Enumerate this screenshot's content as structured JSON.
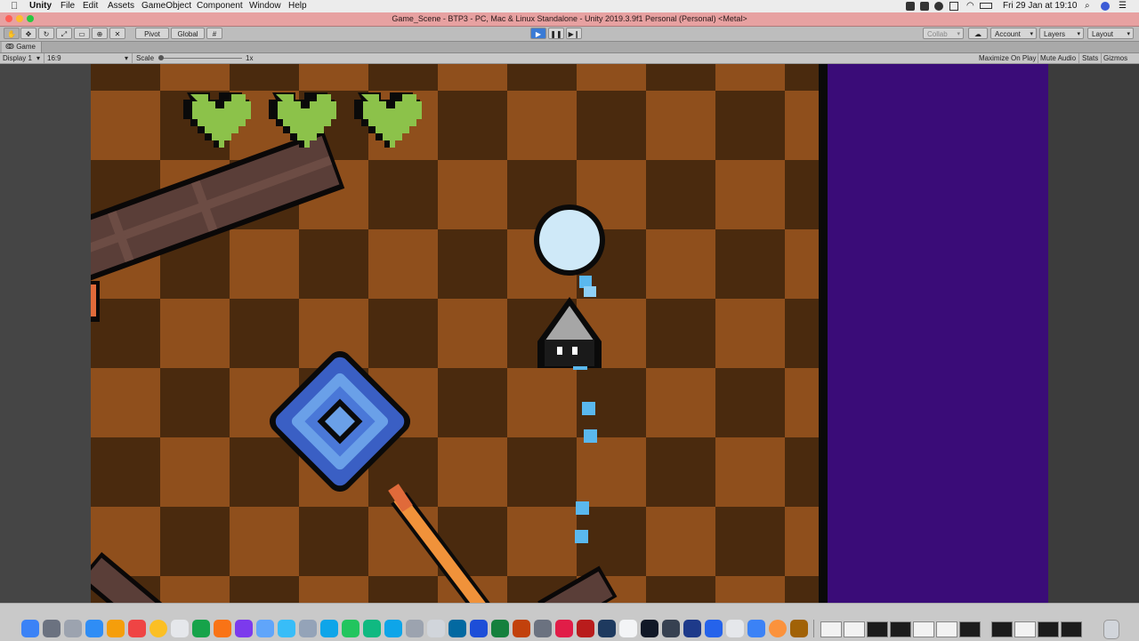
{
  "menubar": {
    "app": "Unity",
    "items": [
      "File",
      "Edit",
      "Assets",
      "GameObject",
      "Component",
      "Window",
      "Help"
    ],
    "clock": "Fri 29 Jan at  19:10"
  },
  "window": {
    "title": "Game_Scene - BTP3 - PC, Mac & Linux Standalone - Unity 2019.3.9f1 Personal (Personal) <Metal>"
  },
  "toolbar": {
    "pivot_label": "Pivot",
    "global_label": "Global",
    "collab_label": "Collab",
    "account_label": "Account",
    "layers_label": "Layers",
    "layout_label": "Layout",
    "play_glyph": "▶",
    "pause_glyph": "❚❚",
    "step_glyph": "▶❙"
  },
  "tab": {
    "label": "Game"
  },
  "gamebar": {
    "display": "Display 1",
    "aspect": "16:9",
    "scale_label": "Scale",
    "scale_value": "1x",
    "maximize": "Maximize On Play",
    "mute": "Mute Audio",
    "stats": "Stats",
    "gizmos": "Gizmos"
  },
  "game": {
    "lives": 3,
    "colors": {
      "board_dark": "#4a2a0e",
      "board_light": "#8f4f1c",
      "heart": "#8cc24a",
      "player_body": "#9a9a9a",
      "projectile": "#5ab8ee",
      "mace_blue": "#4a78d8",
      "wall": "#3a0c78"
    }
  }
}
